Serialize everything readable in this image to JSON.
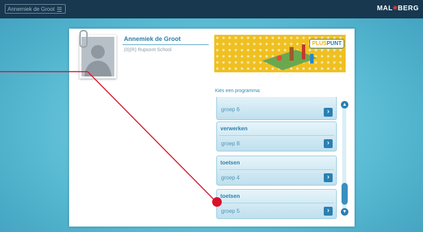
{
  "topbar": {
    "user_menu_label": "Annemiek de Groot",
    "menu_icon": "☰",
    "logo_text": "MAL",
    "logo_text_end": "BERG",
    "logo_mark": "❀"
  },
  "profile": {
    "name": "Annemiek de Groot",
    "school": "(0)(R) Rupsont School"
  },
  "banner": {
    "logo_plus": "PLUS",
    "logo_punt": "PUNT"
  },
  "program": {
    "prompt": "Kies een programma:",
    "items": [
      {
        "title": "",
        "group": "groep 6"
      },
      {
        "title": "verwerken",
        "group": "groep 8"
      },
      {
        "title": "toetsen",
        "group": "groep 4"
      },
      {
        "title": "toetsen",
        "group": "groep 5"
      }
    ],
    "arrow": "›",
    "scroll_up": "▲",
    "scroll_down": "▼"
  },
  "colors": {
    "topbar": "#17384f",
    "accent": "#2a80b2",
    "pointer": "#d9122a",
    "banner": "#efc021"
  }
}
